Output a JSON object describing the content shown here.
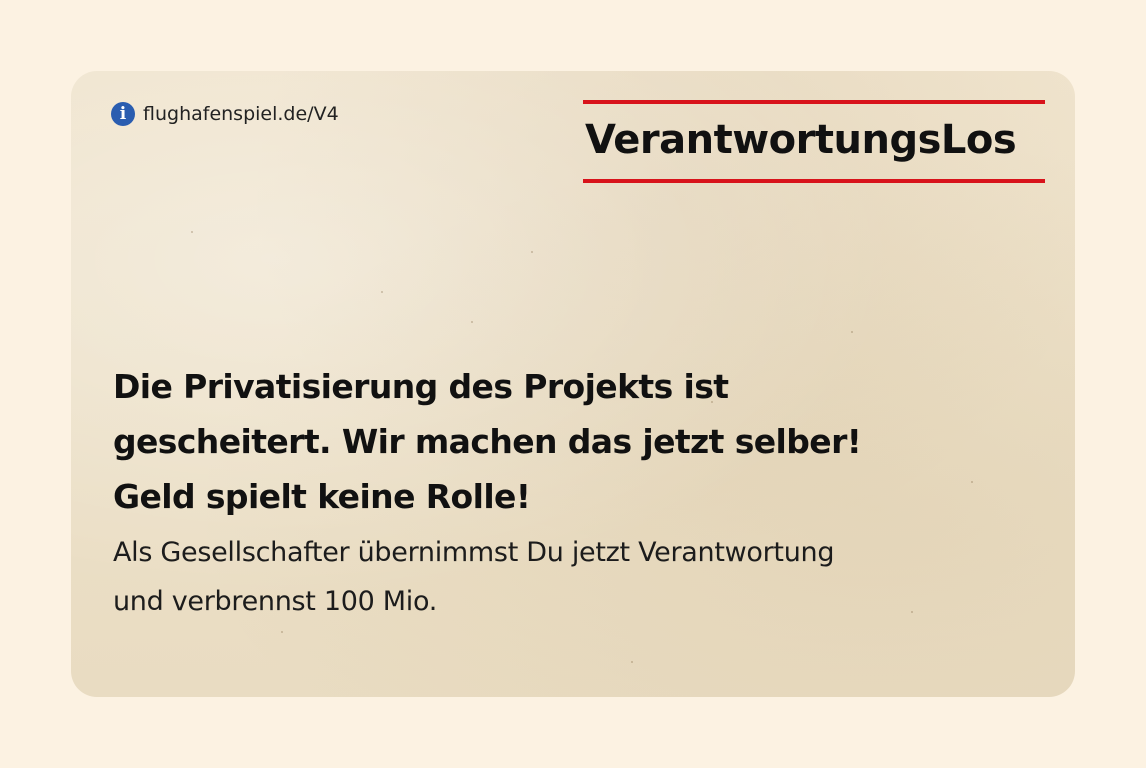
{
  "card": {
    "source_url": "flughafenspiel.de/V4",
    "info_icon": "i",
    "title": "VerantwortungsLos",
    "headline": [
      "Die Privatisierung des Projekts ist",
      "gescheitert. Wir machen das jetzt selber!",
      "Geld spielt keine Rolle!"
    ],
    "body": [
      "Als Gesellschafter übernimmst Du jetzt Verantwortung",
      "und verbrennst 100 Mio."
    ]
  },
  "colors": {
    "page_background": "#fcf2e2",
    "card_paper": "#ece0c7",
    "title_rule": "#d8131b",
    "info_icon": "#2a5db0",
    "text": "#111111"
  },
  "icons": {
    "info": "info-icon"
  }
}
